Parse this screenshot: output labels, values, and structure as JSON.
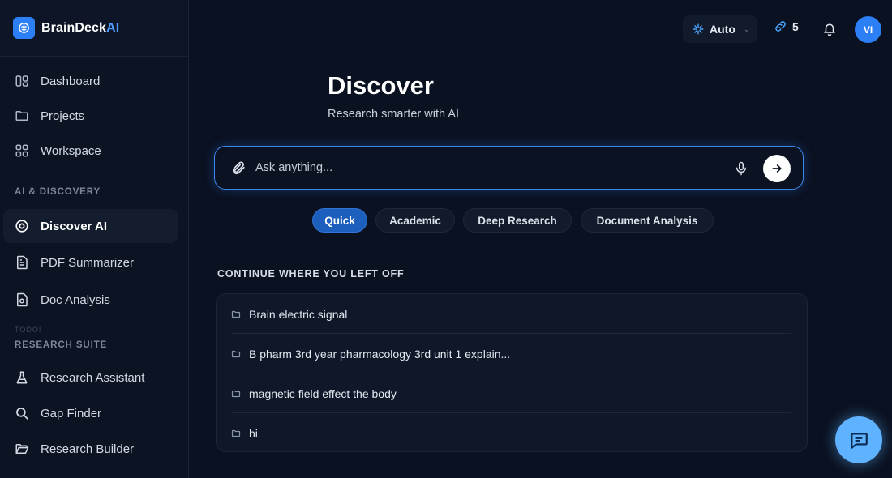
{
  "brand": {
    "name_main": "BrainDeck",
    "name_accent": "AI"
  },
  "sidebar": {
    "items_top": [
      {
        "label": "Dashboard",
        "icon": "dashboard-icon"
      },
      {
        "label": "Projects",
        "icon": "folder-icon"
      },
      {
        "label": "Workspace",
        "icon": "grid-icon"
      }
    ],
    "section_ai": "AI & DISCOVERY",
    "items_ai": [
      {
        "label": "Discover AI",
        "icon": "compass-icon",
        "active": true
      },
      {
        "label": "PDF Summarizer",
        "icon": "pdf-icon"
      },
      {
        "label": "Doc Analysis",
        "icon": "document-icon"
      }
    ],
    "faint_label": "TODO!",
    "section_research": "RESEARCH SUITE",
    "items_research": [
      {
        "label": "Research Assistant",
        "icon": "flask-icon"
      },
      {
        "label": "Gap Finder",
        "icon": "search-icon"
      },
      {
        "label": "Research Builder",
        "icon": "folder-open-icon"
      }
    ]
  },
  "topbar": {
    "model_label": "Auto",
    "links_count": "5",
    "avatar_initials": "VI"
  },
  "hero": {
    "title": "Discover",
    "subtitle": "Research smarter with AI"
  },
  "search": {
    "placeholder": "Ask anything...",
    "value": ""
  },
  "modes": [
    {
      "label": "Quick",
      "active": true
    },
    {
      "label": "Academic"
    },
    {
      "label": "Deep Research"
    },
    {
      "label": "Document Analysis"
    }
  ],
  "continue": {
    "label": "CONTINUE WHERE YOU LEFT OFF",
    "items": [
      "Brain electric signal",
      "B pharm 3rd year pharmacology 3rd unit 1 explain...",
      "magnetic field effect the body",
      "hi"
    ]
  },
  "colors": {
    "accent": "#2d7ff5",
    "background": "#0a1120",
    "chat_fab": "#5fb2ff"
  }
}
